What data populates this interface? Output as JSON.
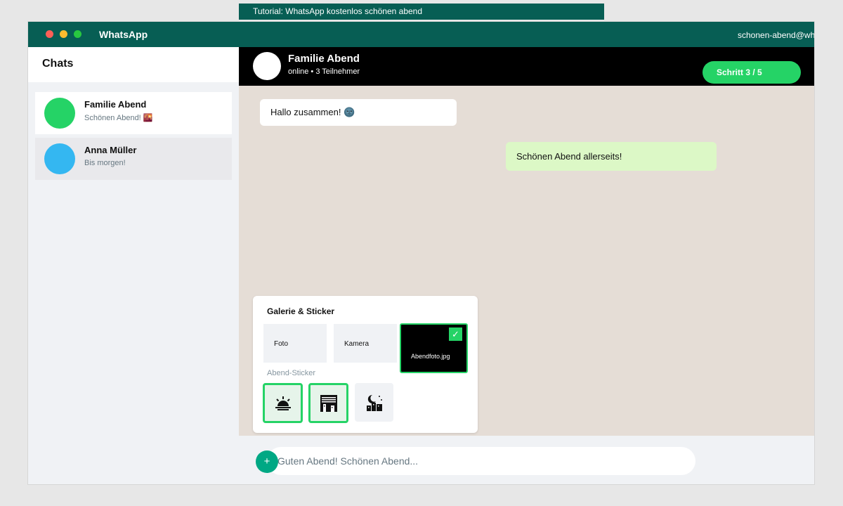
{
  "tutorial": {
    "banner": "Tutorial: WhatsApp kostenlos schönen abend"
  },
  "window": {
    "app_title": "WhatsApp",
    "account": "schonen-abend@whatsapp.de"
  },
  "sidebar": {
    "title": "Chats",
    "chats": [
      {
        "name": "Familie Abend",
        "preview": "Schönen Abend! 🌇",
        "avatar_color": "#25d366"
      },
      {
        "name": "Anna Müller",
        "preview": "Bis morgen!",
        "avatar_color": "#34b7f1"
      }
    ]
  },
  "chat_header": {
    "name": "Familie Abend",
    "status": "online • 3 Teilnehmer",
    "step": "Schritt 3 / 5"
  },
  "messages": {
    "incoming": "Hallo zusammen! 🌚",
    "outgoing": "Schönen Abend allerseits!"
  },
  "picker": {
    "title": "Galerie & Sticker",
    "tiles": [
      "Foto",
      "Kamera",
      "Abendfoto.jpg"
    ],
    "selected_check": "✓",
    "sticker_label": "Abend-Sticker",
    "stickers": [
      "🌅",
      "🌆",
      "🌃"
    ]
  },
  "composer": {
    "placeholder": "Guten Abend! Schönen Abend...",
    "plus": "+"
  },
  "colors": {
    "brand": "#075e54",
    "accent": "#25d366",
    "outgoing_bubble": "#dcf8c6",
    "chat_background": "#e5ddd6"
  }
}
